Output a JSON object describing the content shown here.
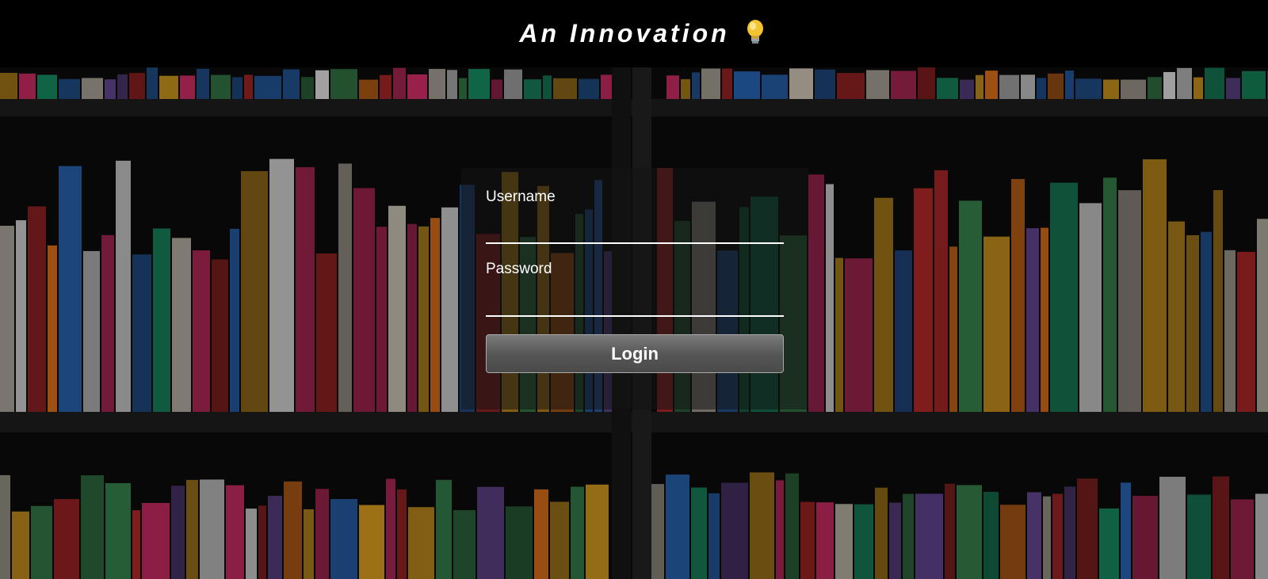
{
  "header": {
    "title": "An Innovation",
    "icon": "lightbulb-icon"
  },
  "background": {
    "description_icon": "bookshelf-photo",
    "palette": [
      "#e0306e",
      "#e8a820",
      "#1aa070",
      "#f07a1a",
      "#2a6bc0",
      "#d8d0c0",
      "#c02a2a",
      "#3a8a50",
      "#f0f0f0",
      "#6a4a9a"
    ]
  },
  "login": {
    "username_label": "Username",
    "username_value": "",
    "password_label": "Password",
    "password_value": "",
    "button_label": "Login"
  }
}
